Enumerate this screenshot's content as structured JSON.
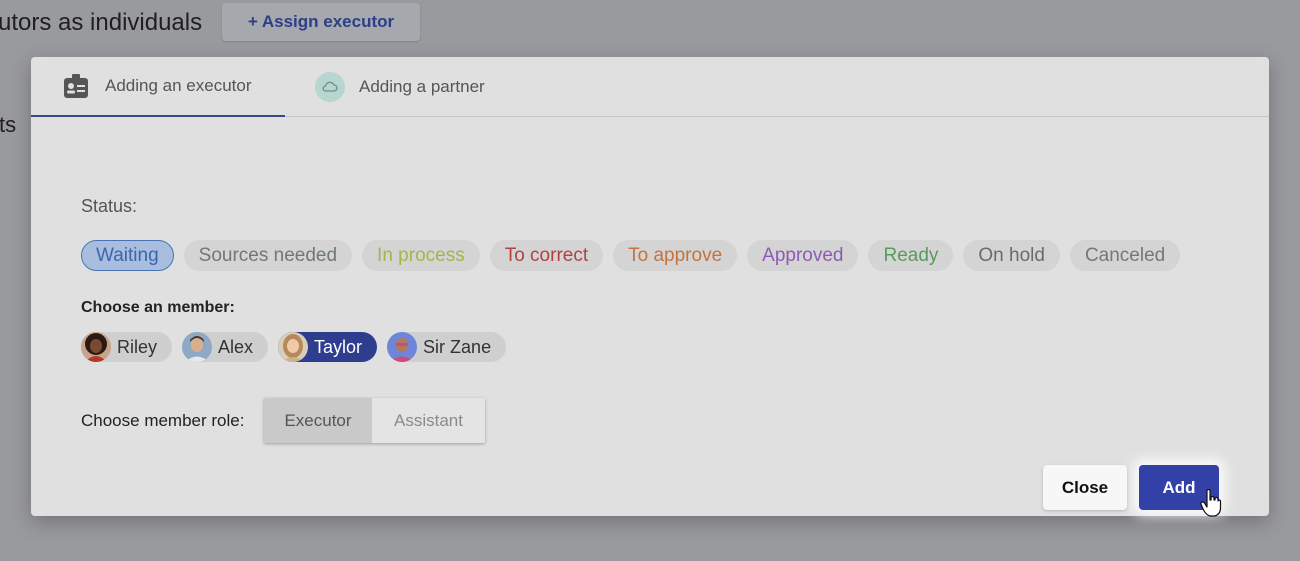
{
  "background": {
    "heading": "utors as individuals",
    "assign_button": "+ Assign executor",
    "side_fragment": "ts"
  },
  "modal": {
    "tabs": [
      {
        "label": "Adding an executor",
        "icon": "id-badge-icon",
        "active": true
      },
      {
        "label": "Adding a partner",
        "icon": "cloud-icon",
        "active": false
      }
    ],
    "status_label": "Status:",
    "statuses": [
      {
        "label": "Waiting",
        "color": "#3a66b0",
        "selected": true
      },
      {
        "label": "Sources needed",
        "color": "#6f7a6f",
        "selected": false
      },
      {
        "label": "In process",
        "color": "#a9b34a",
        "selected": false
      },
      {
        "label": "To correct",
        "color": "#b54040",
        "selected": false
      },
      {
        "label": "To approve",
        "color": "#c4733e",
        "selected": false
      },
      {
        "label": "Approved",
        "color": "#8e5bb4",
        "selected": false
      },
      {
        "label": "Ready",
        "color": "#5a9a5a",
        "selected": false
      },
      {
        "label": "On hold",
        "color": "#6b6b6b",
        "selected": false
      },
      {
        "label": "Canceled",
        "color": "#777777",
        "selected": false
      }
    ],
    "member_label": "Choose an member:",
    "members": [
      {
        "name": "Riley",
        "selected": false
      },
      {
        "name": "Alex",
        "selected": false
      },
      {
        "name": "Taylor",
        "selected": true
      },
      {
        "name": "Sir Zane",
        "selected": false
      }
    ],
    "role_label": "Choose member role:",
    "roles": [
      {
        "label": "Executor",
        "selected": true
      },
      {
        "label": "Assistant",
        "selected": false
      }
    ],
    "close_button": "Close",
    "add_button": "Add"
  },
  "colors": {
    "accent": "#3340a8",
    "selected_member": "#2f3d8e",
    "tab_underline": "#3a4789"
  }
}
